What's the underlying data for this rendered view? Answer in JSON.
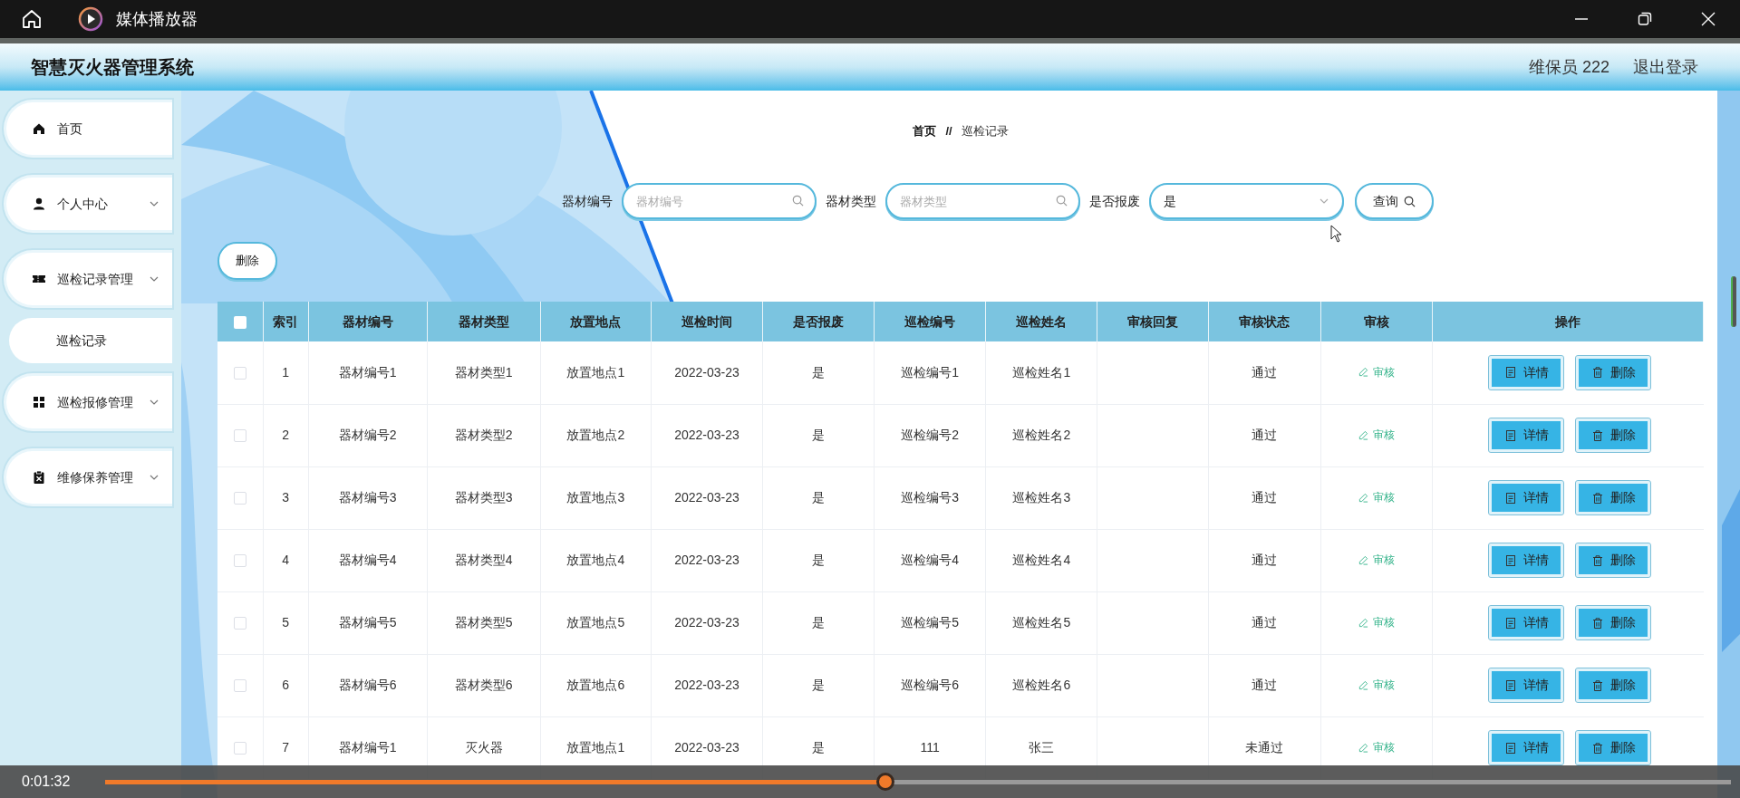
{
  "player": {
    "title": "媒体播放器",
    "time": "0:01:32",
    "level": 0.48
  },
  "app": {
    "title": "智慧灭火器管理系统",
    "user": "维保员 222",
    "logout": "退出登录"
  },
  "sidebar": {
    "items": [
      {
        "label": "首页",
        "kind": "link"
      },
      {
        "label": "个人中心",
        "kind": "menu"
      },
      {
        "label": "巡检记录管理",
        "kind": "menu",
        "children": [
          {
            "label": "巡检记录"
          }
        ]
      },
      {
        "label": "巡检报修管理",
        "kind": "menu"
      },
      {
        "label": "维修保养管理",
        "kind": "menu"
      }
    ]
  },
  "breadcrumb": {
    "items": [
      "首页",
      "巡检记录"
    ],
    "separator": "//"
  },
  "search": {
    "fields": [
      {
        "label": "器材编号",
        "kind": "text",
        "placeholder": "器材编号"
      },
      {
        "label": "器材类型",
        "kind": "text",
        "placeholder": "器材类型"
      },
      {
        "label": "是否报废",
        "kind": "select",
        "value": "是"
      }
    ],
    "button": "查询"
  },
  "delete_button": "删除",
  "table": {
    "header_checked": false,
    "columns": [
      "索引",
      "器材编号",
      "器材类型",
      "放置地点",
      "巡检时间",
      "是否报废",
      "巡检编号",
      "巡检姓名",
      "审核回复",
      "审核状态",
      "审核",
      "操作"
    ],
    "rows": [
      {
        "checked": false,
        "index": "1",
        "equipment_no": "器材编号1",
        "equipment_type": "器材类型1",
        "location": "放置地点1",
        "time": "2022-03-23",
        "scrapped": "是",
        "inspection_no": "巡检编号1",
        "inspector": "巡检姓名1",
        "status": "通过",
        "audit": "审核",
        "actions": [
          "详情",
          "删除"
        ]
      },
      {
        "checked": false,
        "index": "2",
        "equipment_no": "器材编号2",
        "equipment_type": "器材类型2",
        "location": "放置地点2",
        "time": "2022-03-23",
        "scrapped": "是",
        "inspection_no": "巡检编号2",
        "inspector": "巡检姓名2",
        "status": "通过",
        "audit": "审核",
        "actions": [
          "详情",
          "删除"
        ]
      },
      {
        "checked": false,
        "index": "3",
        "equipment_no": "器材编号3",
        "equipment_type": "器材类型3",
        "location": "放置地点3",
        "time": "2022-03-23",
        "scrapped": "是",
        "inspection_no": "巡检编号3",
        "inspector": "巡检姓名3",
        "status": "通过",
        "audit": "审核",
        "actions": [
          "详情",
          "删除"
        ]
      },
      {
        "checked": false,
        "index": "4",
        "equipment_no": "器材编号4",
        "equipment_type": "器材类型4",
        "location": "放置地点4",
        "time": "2022-03-23",
        "scrapped": "是",
        "inspection_no": "巡检编号4",
        "inspector": "巡检姓名4",
        "status": "通过",
        "audit": "审核",
        "actions": [
          "详情",
          "删除"
        ]
      },
      {
        "checked": false,
        "index": "5",
        "equipment_no": "器材编号5",
        "equipment_type": "器材类型5",
        "location": "放置地点5",
        "time": "2022-03-23",
        "scrapped": "是",
        "inspection_no": "巡检编号5",
        "inspector": "巡检姓名5",
        "status": "通过",
        "audit": "审核",
        "actions": [
          "详情",
          "删除"
        ]
      },
      {
        "checked": false,
        "index": "6",
        "equipment_no": "器材编号6",
        "equipment_type": "器材类型6",
        "location": "放置地点6",
        "time": "2022-03-23",
        "scrapped": "是",
        "inspection_no": "巡检编号6",
        "inspector": "巡检姓名6",
        "status": "通过",
        "audit": "审核",
        "actions": [
          "详情",
          "删除"
        ]
      },
      {
        "checked": false,
        "index": "7",
        "equipment_no": "器材编号1",
        "equipment_type": "灭火器",
        "location": "放置地点1",
        "time": "2022-03-23",
        "scrapped": "是",
        "inspection_no": "111",
        "inspector": "张三",
        "status": "未通过",
        "audit": "审核",
        "actions": [
          "详情",
          "删除"
        ]
      }
    ]
  }
}
